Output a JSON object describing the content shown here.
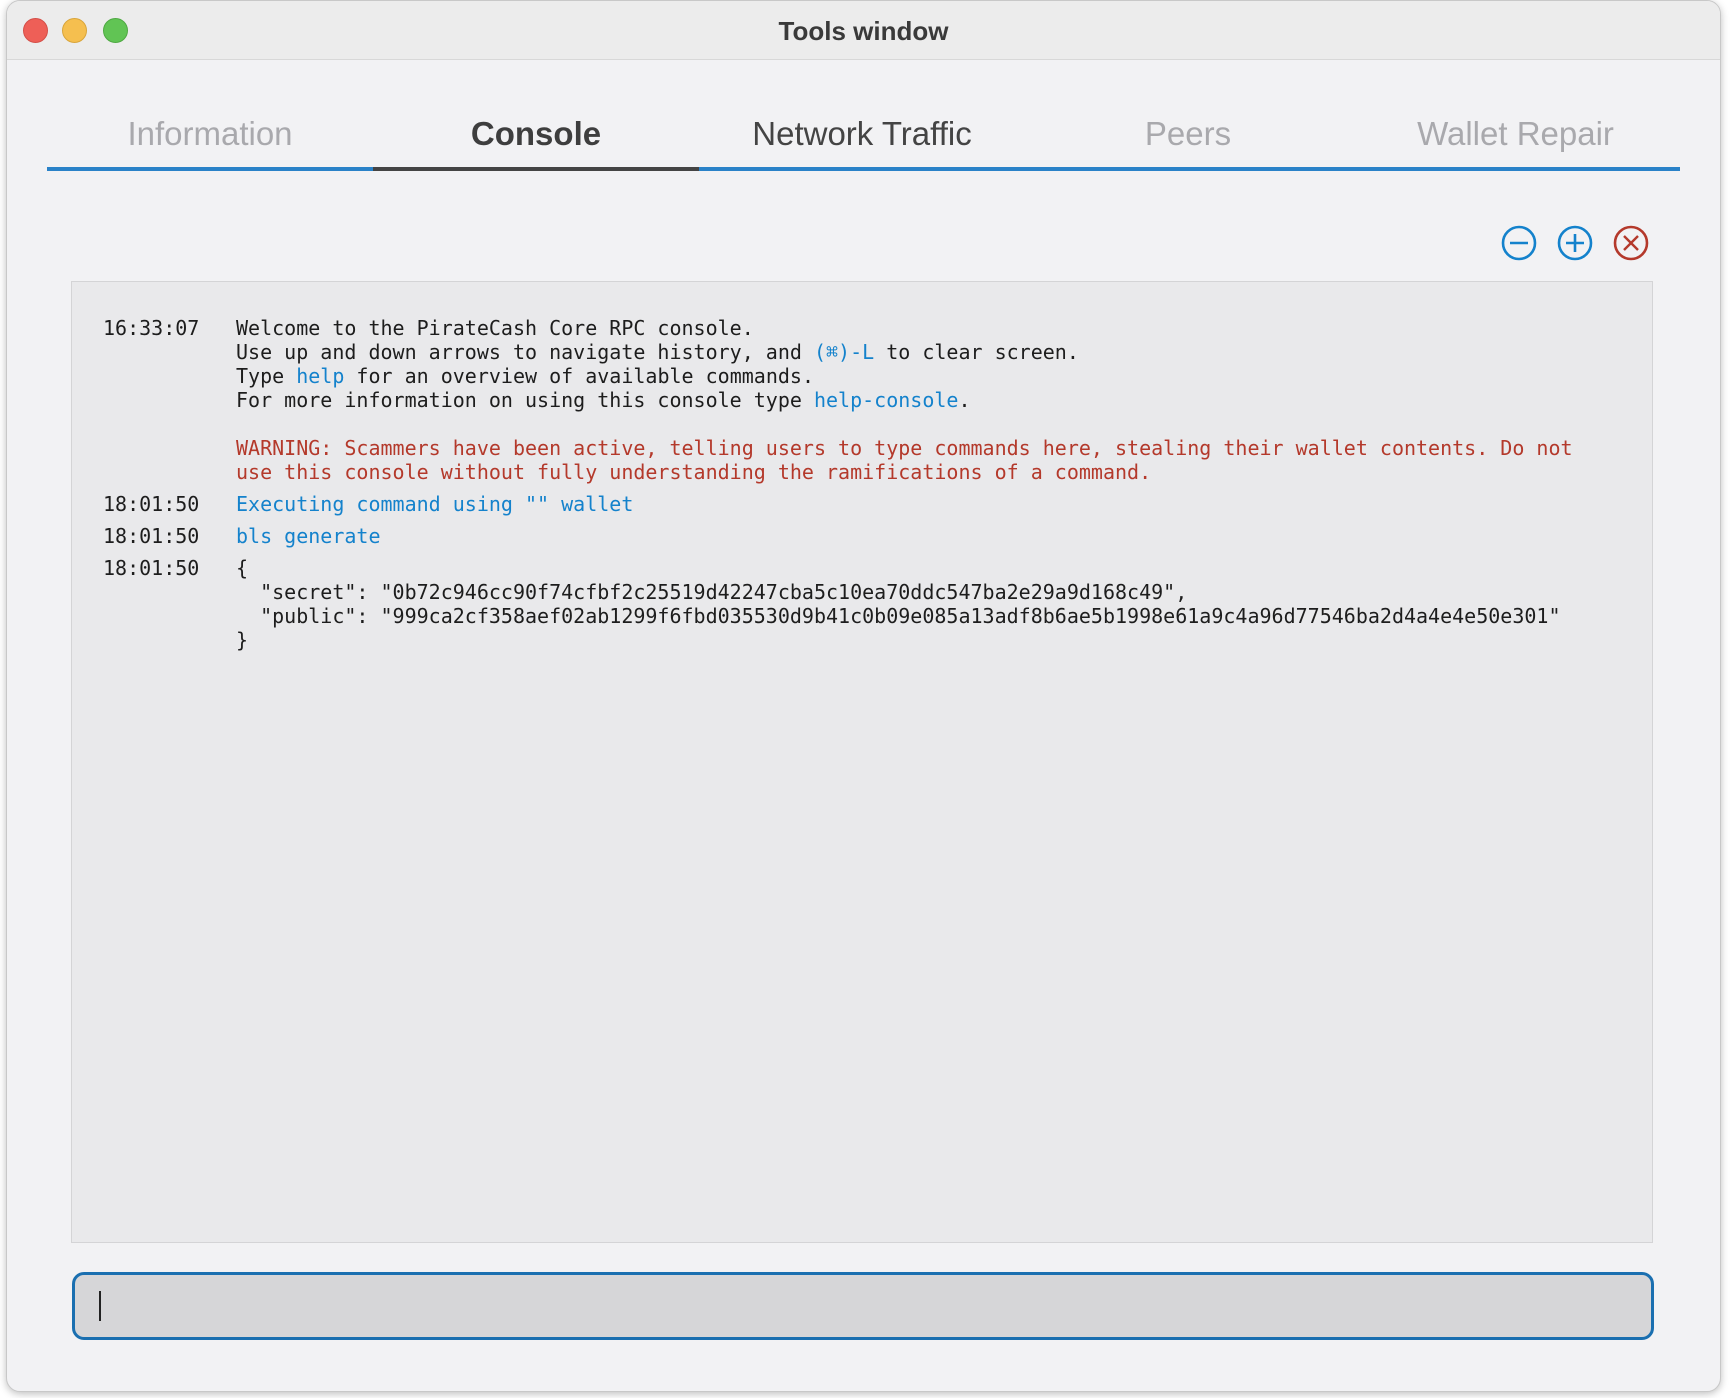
{
  "window": {
    "title": "Tools window"
  },
  "tabs": [
    {
      "label": "Information"
    },
    {
      "label": "Console"
    },
    {
      "label": "Network Traffic"
    },
    {
      "label": "Peers"
    },
    {
      "label": "Wallet Repair"
    }
  ],
  "active_tab": "Console",
  "toolbar": {
    "font_smaller_icon": "minus-circle",
    "font_larger_icon": "plus-circle",
    "clear_icon": "x-circle"
  },
  "console": {
    "entries": [
      {
        "time": "16:33:07",
        "welcome": "Welcome to the PirateCash Core RPC console.",
        "line2_a": "Use up and down arrows to navigate history, and ",
        "line2_key": "(⌘)-L",
        "line2_b": " to clear screen.",
        "line3_a": "Type ",
        "line3_cmd": "help",
        "line3_b": " for an overview of available commands.",
        "line4_a": "For more information on using this console type ",
        "line4_cmd": "help-console",
        "line4_b": ".",
        "warning_1": "WARNING: Scammers have been active, telling users to type commands here, stealing their wallet contents. Do not",
        "warning_2": "use this console without fully understanding the ramifications of a command."
      },
      {
        "time": "18:01:50",
        "text": "Executing command using \"\" wallet"
      },
      {
        "time": "18:01:50",
        "text": "bls generate"
      },
      {
        "time": "18:01:50",
        "line1": "{",
        "line2": "  \"secret\": \"0b72c946cc90f74cfbf2c25519d42247cba5c10ea70ddc547ba2e29a9d168c49\",",
        "line3": "  \"public\": \"999ca2cf358aef02ab1299f6fbd035530d9b41c0b09e085a13adf8b6ae5b1998e61a9c4a96d77546ba2d4a4e4e50e301\"",
        "line4": "}"
      }
    ]
  },
  "input": {
    "value": ""
  },
  "colors": {
    "accent": "#1482cc",
    "warning": "#b4392b",
    "clear_button": "#b4392b"
  }
}
